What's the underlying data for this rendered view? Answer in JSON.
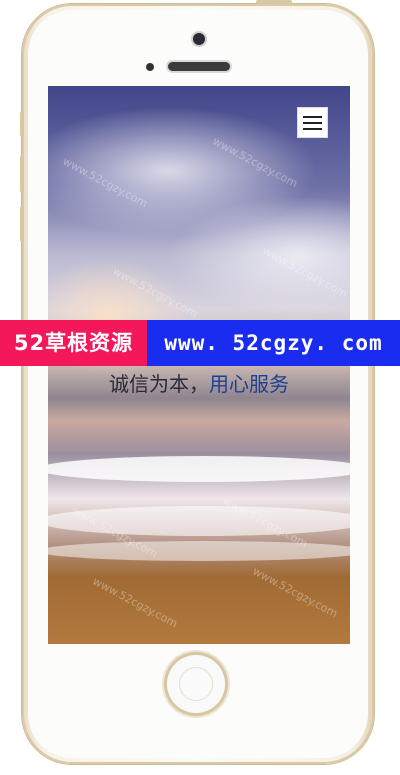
{
  "banner": {
    "brand_cn": "52草根资源",
    "site_url": "www. 52cgzy. com"
  },
  "hero": {
    "slogan_part1": "诚信为本，",
    "slogan_part2": "用心服务"
  },
  "watermark": {
    "text": "www.52cgzy.com"
  },
  "icons": {
    "menu": "hamburger-menu-icon",
    "home": "home-button-icon",
    "camera": "front-camera-icon",
    "speaker": "earpiece-speaker-icon"
  },
  "colors": {
    "banner_red": "#f2185a",
    "banner_blue": "#1a2cf0",
    "slogan_accent": "#1f3f8f"
  }
}
